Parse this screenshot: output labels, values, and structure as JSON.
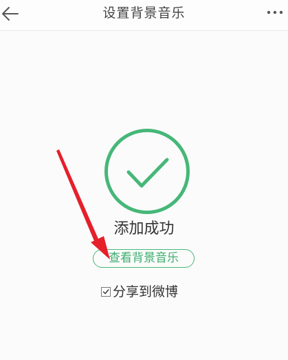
{
  "header": {
    "title": "设置背景音乐",
    "back_icon": "back-arrow-icon",
    "more_icon": "more-dots-icon"
  },
  "result": {
    "icon": "success-check-icon",
    "message": "添加成功",
    "view_button_label": "查看背景音乐"
  },
  "share": {
    "label": "分享到微博",
    "checked": true
  },
  "colors": {
    "accent_green": "#46b778",
    "annotation_red": "#e5202b"
  }
}
